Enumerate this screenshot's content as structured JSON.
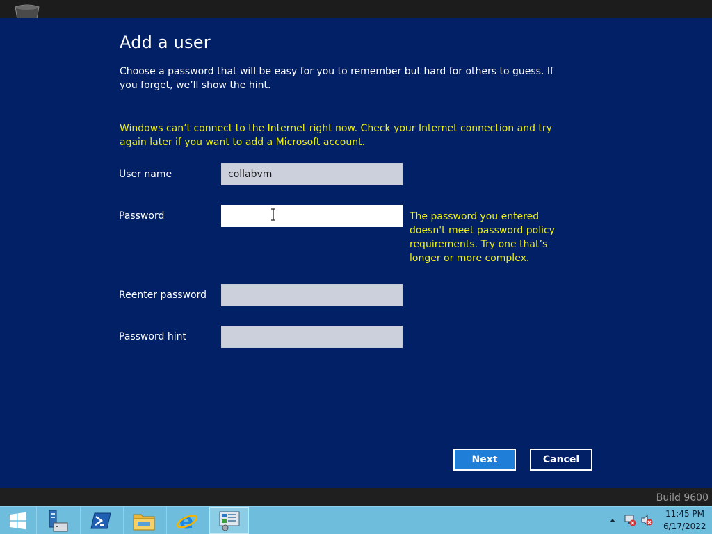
{
  "dialog": {
    "title": "Add a user",
    "description": "Choose a password that will be easy for you to remember but hard for others to guess. If you forget, we’ll show the hint.",
    "warning": "Windows can’t connect to the Internet right now. Check your Internet connection and try again later if you want to add a Microsoft account.",
    "fields": {
      "username": {
        "label": "User name",
        "value": "collabvm"
      },
      "password": {
        "label": "Password",
        "value": ""
      },
      "reenter": {
        "label": "Reenter password",
        "value": ""
      },
      "hint": {
        "label": "Password hint",
        "value": ""
      }
    },
    "password_error": "The password you entered doesn't meet password policy requirements. Try one that’s longer or more complex.",
    "next_label": "Next",
    "cancel_label": "Cancel"
  },
  "watermark": {
    "build": "Build 9600"
  },
  "taskbar": {
    "items": [
      {
        "name": "start",
        "icon": "windows-logo-icon"
      },
      {
        "name": "server-manager",
        "icon": "server-manager-icon"
      },
      {
        "name": "powershell",
        "icon": "powershell-icon"
      },
      {
        "name": "file-explorer",
        "icon": "folder-icon"
      },
      {
        "name": "internet-explorer",
        "icon": "internet-explorer-icon"
      },
      {
        "name": "control-panel",
        "icon": "control-panel-icon",
        "running": true
      }
    ],
    "tray": {
      "icons": [
        "show-hidden-icons-arrow",
        "network-disconnected-icon",
        "volume-muted-icon"
      ],
      "time": "11:45 PM",
      "date": "6/17/2022"
    }
  },
  "colors": {
    "dialog_bg": "#022066",
    "warning_text": "#eef00d",
    "taskbar_bg": "#6fbddc",
    "next_button": "#1e7ed8"
  }
}
